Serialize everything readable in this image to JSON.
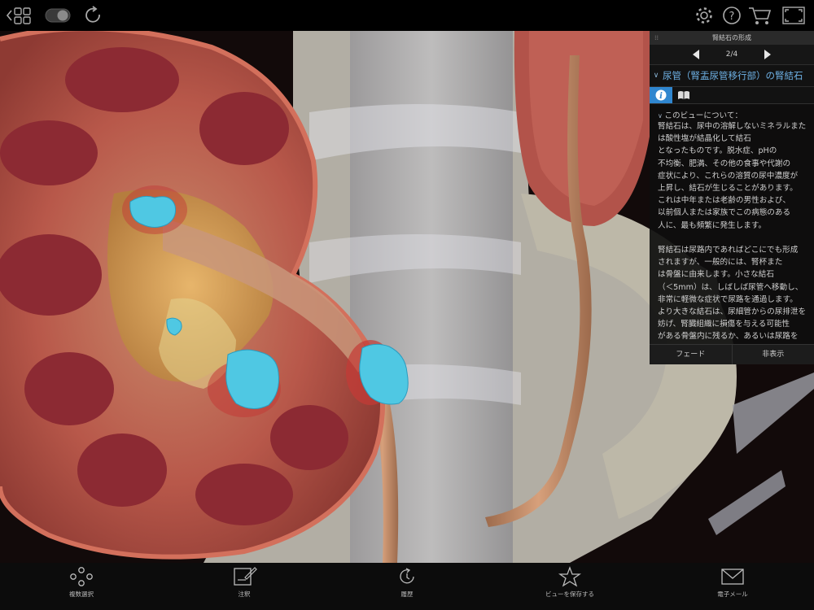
{
  "panel": {
    "header": "腎結石の形成",
    "page": "2/4",
    "title": "尿管（腎盂尿管移行部）の腎結石",
    "about_label": "このビューについて：",
    "body_text": "腎結石は、尿中の溶解しないミネラルまた\nは酸性塩が結晶化して結石\nとなったものです。脱水症、pHの\n不均衡、肥満、その他の食事や代謝の\n症状により、これらの溶質の尿中濃度が\n上昇し、結石が生じることがあります。\nこれは中年または老齢の男性および、\n以前個人または家族でこの病態のある\n人に、最も頻繁に発生します。\n\n腎結石は尿路内であればどこにでも形成\nされますが、一般的には、腎杯また\nは骨盤に由来します。小さな結石\n（＜5mm）は、しばしば尿管へ移動し、\n非常に軽微な症状で尿路を通過します。\nより大きな結石は、尿細管からの尿排泄を\n妨げ、腎臓組織に損傷を与える可能性\nがある骨盤内に残るか、あるいは尿路を\n通過する時に困難を伴います。",
    "fade_label": "フェード",
    "hide_label": "非表示"
  },
  "bottom_toolbar": {
    "multi_select": "複数選択",
    "annotate": "注釈",
    "history": "履歴",
    "save_view": "ビューを保存する",
    "email": "電子メール"
  },
  "colors": {
    "accent": "#2f86cf",
    "title": "#6fb2e6",
    "stone": "#4fc8e3"
  },
  "icons": [
    "back-grid-icon",
    "toggle-icon",
    "reset-icon",
    "settings-icon",
    "help-icon",
    "cart-icon",
    "fullscreen-icon",
    "info-icon",
    "book-icon"
  ]
}
